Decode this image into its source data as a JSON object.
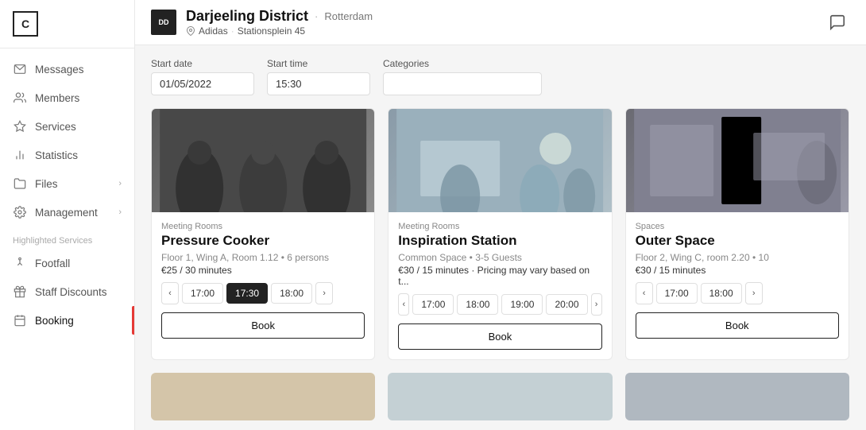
{
  "app": {
    "logo_text": "C"
  },
  "header": {
    "badge_text": "DD",
    "location_name": "Darjeeling District",
    "location_city": "Rotterdam",
    "partner_name": "Adidas",
    "partner_address": "Stationsplein 45"
  },
  "sidebar": {
    "nav_items": [
      {
        "id": "messages",
        "label": "Messages",
        "icon": "mail"
      },
      {
        "id": "members",
        "label": "Members",
        "icon": "users"
      },
      {
        "id": "services",
        "label": "Services",
        "icon": "star"
      },
      {
        "id": "statistics",
        "label": "Statistics",
        "icon": "chart"
      },
      {
        "id": "files",
        "label": "Files",
        "icon": "folder",
        "has_chevron": true
      },
      {
        "id": "management",
        "label": "Management",
        "icon": "settings",
        "has_chevron": true
      }
    ],
    "section_label": "Highlighted Services",
    "highlighted_items": [
      {
        "id": "footfall",
        "label": "Footfall",
        "icon": "footfall"
      },
      {
        "id": "staff-discounts",
        "label": "Staff Discounts",
        "icon": "gift"
      },
      {
        "id": "booking",
        "label": "Booking",
        "icon": "calendar",
        "active": true
      }
    ]
  },
  "filters": {
    "start_date_label": "Start date",
    "start_date_value": "01/05/2022",
    "start_time_label": "Start time",
    "start_time_value": "15:30",
    "categories_label": "Categories",
    "categories_value": ""
  },
  "cards": [
    {
      "category": "Meeting Rooms",
      "title": "Pressure Cooker",
      "location": "Floor 1, Wing A, Room 1.12 • 6 persons",
      "pricing": "€25 / 30 minutes",
      "slots": [
        "17:00",
        "17:30",
        "18:00"
      ],
      "selected_slot": "17:30",
      "book_label": "Book",
      "image_color": "#6b7280"
    },
    {
      "category": "Meeting Rooms",
      "title": "Inspiration Station",
      "location": "Common Space • 3-5 Guests",
      "pricing": "€30 / 15 minutes · Pricing may vary based on t...",
      "slots": [
        "17:00",
        "18:00",
        "19:00",
        "20:00"
      ],
      "selected_slot": null,
      "book_label": "Book",
      "image_color": "#9ca3af"
    },
    {
      "category": "Spaces",
      "title": "Outer Space",
      "location": "Floor 2, Wing C, room 2.20 • 10",
      "pricing": "€30 / 15 minutes",
      "slots": [
        "17:00",
        "18:00"
      ],
      "selected_slot": null,
      "book_label": "Book",
      "image_color": "#b8bcc4"
    }
  ],
  "preview_cards": [
    {
      "color": "#d4c5a9"
    },
    {
      "color": "#c4d0d4"
    },
    {
      "color": "#b0b8c0"
    }
  ]
}
